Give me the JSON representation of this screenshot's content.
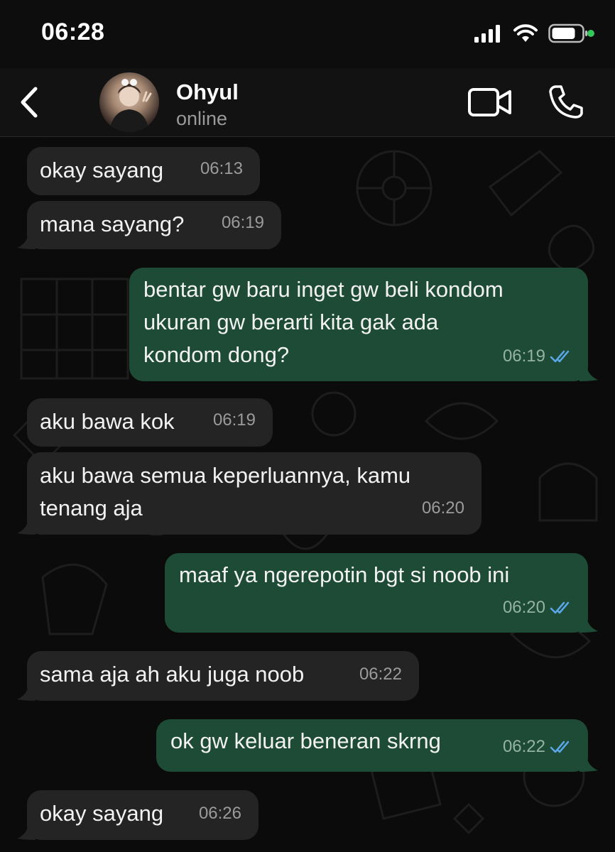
{
  "status_bar": {
    "time": "06:28"
  },
  "header": {
    "back_icon": "chevron-left-icon",
    "contact_name": "Ohyul",
    "contact_status": "online",
    "video_icon": "video-camera-icon",
    "call_icon": "phone-icon"
  },
  "colors": {
    "incoming_bubble": "#242424",
    "outgoing_bubble": "#1e4b36",
    "read_ticks": "#5aa6e6",
    "battery_dot": "#34c759"
  },
  "messages": [
    {
      "direction": "incoming",
      "text": "okay sayang",
      "time": "06:13"
    },
    {
      "direction": "incoming",
      "text": "mana sayang?",
      "time": "06:19"
    },
    {
      "direction": "outgoing",
      "lines": [
        "bentar gw baru inget gw beli kondom",
        "ukuran gw berarti kita gak ada",
        "kondom dong?"
      ],
      "time": "06:19",
      "status": "read"
    },
    {
      "direction": "incoming",
      "text": "aku bawa kok",
      "time": "06:19"
    },
    {
      "direction": "incoming",
      "lines": [
        "aku bawa semua keperluannya, kamu",
        "tenang aja"
      ],
      "time": "06:20"
    },
    {
      "direction": "outgoing",
      "text": "maaf ya ngerepotin bgt si noob ini",
      "time": "06:20",
      "status": "read"
    },
    {
      "direction": "incoming",
      "text": "sama aja ah aku juga noob",
      "time": "06:22"
    },
    {
      "direction": "outgoing",
      "text": "ok gw keluar beneran skrng",
      "time": "06:22",
      "status": "read"
    },
    {
      "direction": "incoming",
      "text": "okay sayang",
      "time": "06:26"
    }
  ]
}
